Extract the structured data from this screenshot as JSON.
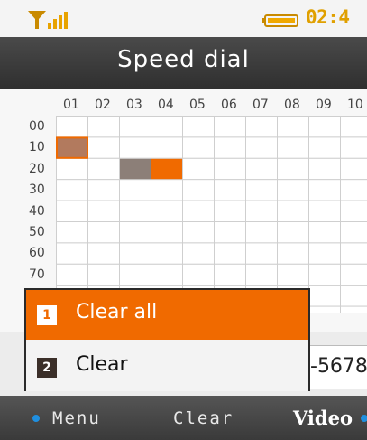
{
  "status": {
    "time": "02:4",
    "signal_icon": "signal-strength-icon",
    "battery_icon": "battery-icon",
    "accent_color": "#e0a000"
  },
  "title": "Speed dial",
  "grid": {
    "columns": [
      "01",
      "02",
      "03",
      "04",
      "05",
      "06",
      "07",
      "08",
      "09",
      "10"
    ],
    "rows": [
      "00",
      "10",
      "20",
      "30",
      "40",
      "50",
      "60",
      "70"
    ],
    "filled_cells": [
      {
        "row": "10",
        "col": "01",
        "state": "assigned",
        "color": "#b27a5e"
      },
      {
        "row": "20",
        "col": "03",
        "state": "assigned",
        "color": "#8c7f78"
      },
      {
        "row": "20",
        "col": "04",
        "state": "selected",
        "color": "#f06a00"
      }
    ]
  },
  "popup": {
    "items": [
      {
        "number": "1",
        "label": "Clear all",
        "selected": true
      },
      {
        "number": "2",
        "label": "Clear",
        "selected": false
      }
    ]
  },
  "number_field": {
    "value": "-5678"
  },
  "softkeys": {
    "left": "Menu",
    "center": "Clear",
    "right": "Video"
  },
  "colors": {
    "highlight": "#f06a00",
    "softkey_dot": "#1f8fe0"
  }
}
